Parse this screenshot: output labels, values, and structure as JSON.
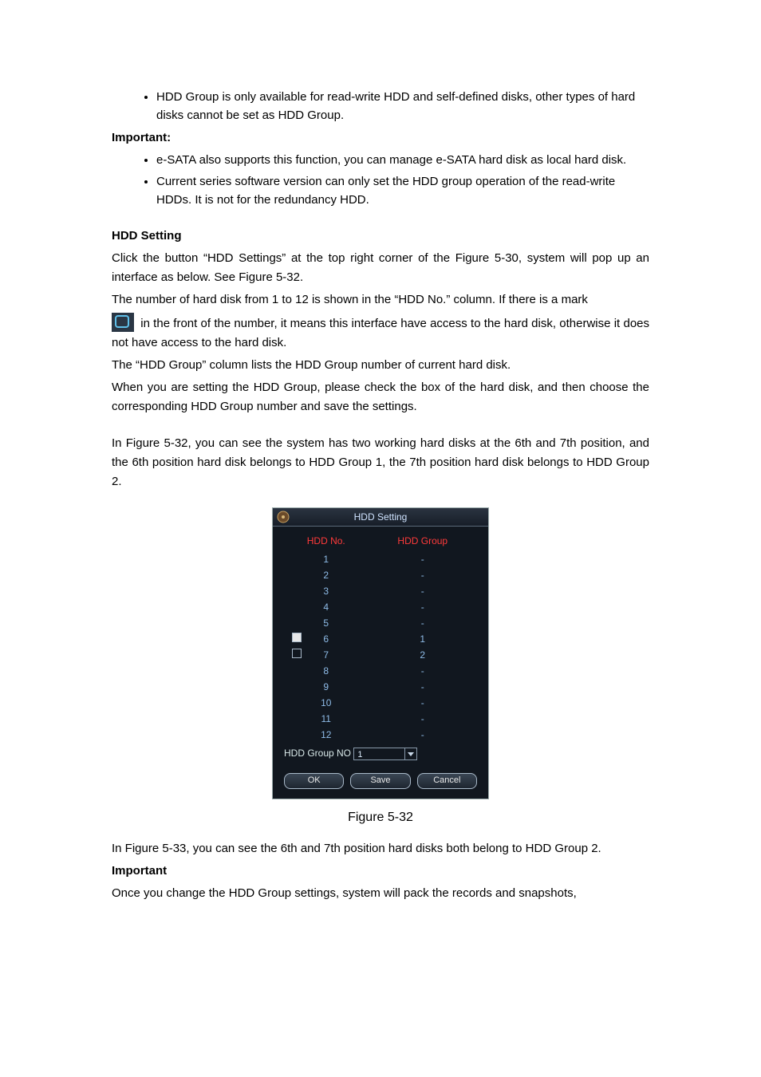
{
  "bullets_top": [
    "HDD Group is only available for read-write HDD and self-defined disks, other types of hard disks cannot be set as HDD Group."
  ],
  "important_label": "Important:",
  "bullets_important": [
    "e-SATA also supports this function, you can manage e-SATA hard disk as local hard disk.",
    "Current series software version can only set the HDD group operation of the read-write HDDs. It is not for the redundancy HDD."
  ],
  "hdd_setting_heading": "HDD Setting",
  "para1": "Click the button “HDD Settings” at the top right corner of the Figure 5-30, system will pop up an interface as below. See Figure 5-32.",
  "para2": "The number of hard disk from 1 to 12 is shown in the “HDD No.” column. If there is a mark",
  "para3_after_icon": " in the front of the number, it means this interface have access to the hard disk, otherwise it does not have access to the hard disk.",
  "para4": "The “HDD Group” column lists the HDD Group number of current hard disk.",
  "para5": "When you are setting the HDD Group, please check the box of the hard disk, and then choose the corresponding HDD Group number and save the settings.",
  "para6": "In Figure 5-32, you can see the system has two working hard disks at the 6th and 7th position, and the 6th position hard disk belongs to HDD Group 1, the 7th position hard disk belongs to HDD Group 2.",
  "dialog": {
    "title": "HDD Setting",
    "col1": "HDD No.",
    "col2": "HDD Group",
    "rows": [
      {
        "no": "1",
        "group": "-",
        "mark": null
      },
      {
        "no": "2",
        "group": "-",
        "mark": null
      },
      {
        "no": "3",
        "group": "-",
        "mark": null
      },
      {
        "no": "4",
        "group": "-",
        "mark": null
      },
      {
        "no": "5",
        "group": "-",
        "mark": null
      },
      {
        "no": "6",
        "group": "1",
        "mark": "filled"
      },
      {
        "no": "7",
        "group": "2",
        "mark": "empty"
      },
      {
        "no": "8",
        "group": "-",
        "mark": null
      },
      {
        "no": "9",
        "group": "-",
        "mark": null
      },
      {
        "no": "10",
        "group": "-",
        "mark": null
      },
      {
        "no": "11",
        "group": "-",
        "mark": null
      },
      {
        "no": "12",
        "group": "-",
        "mark": null
      }
    ],
    "group_no_label": "HDD Group NO",
    "group_no_value": "1",
    "btn_ok": "OK",
    "btn_save": "Save",
    "btn_cancel": "Cancel"
  },
  "figure_caption": "Figure 5-32",
  "para7": "In Figure 5-33, you can see the 6th and 7th position hard disks both belong to HDD Group 2.",
  "important2_label": "Important",
  "para8": "Once you change the HDD Group settings, system will pack the records and snapshots,"
}
